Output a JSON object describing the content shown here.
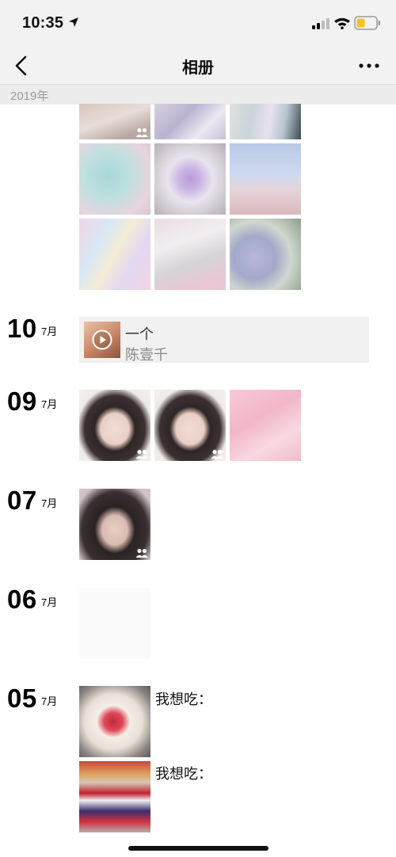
{
  "status_bar": {
    "time": "10:35",
    "battery_color": "#f5c518"
  },
  "nav": {
    "title": "相册",
    "back_icon": "chevron-left-icon",
    "more_icon": "more-icon"
  },
  "year_header": "2019年",
  "days": [
    {
      "day": "10",
      "month": "7月"
    },
    {
      "day": "09",
      "month": "7月"
    },
    {
      "day": "07",
      "month": "7月"
    },
    {
      "day": "06",
      "month": "7月"
    },
    {
      "day": "05",
      "month": "7月"
    }
  ],
  "music": {
    "title": "一个",
    "artist": "陈壹千",
    "play_icon": "play-icon"
  },
  "posts": [
    {
      "text": "我想吃："
    },
    {
      "text": "我想吃："
    }
  ]
}
